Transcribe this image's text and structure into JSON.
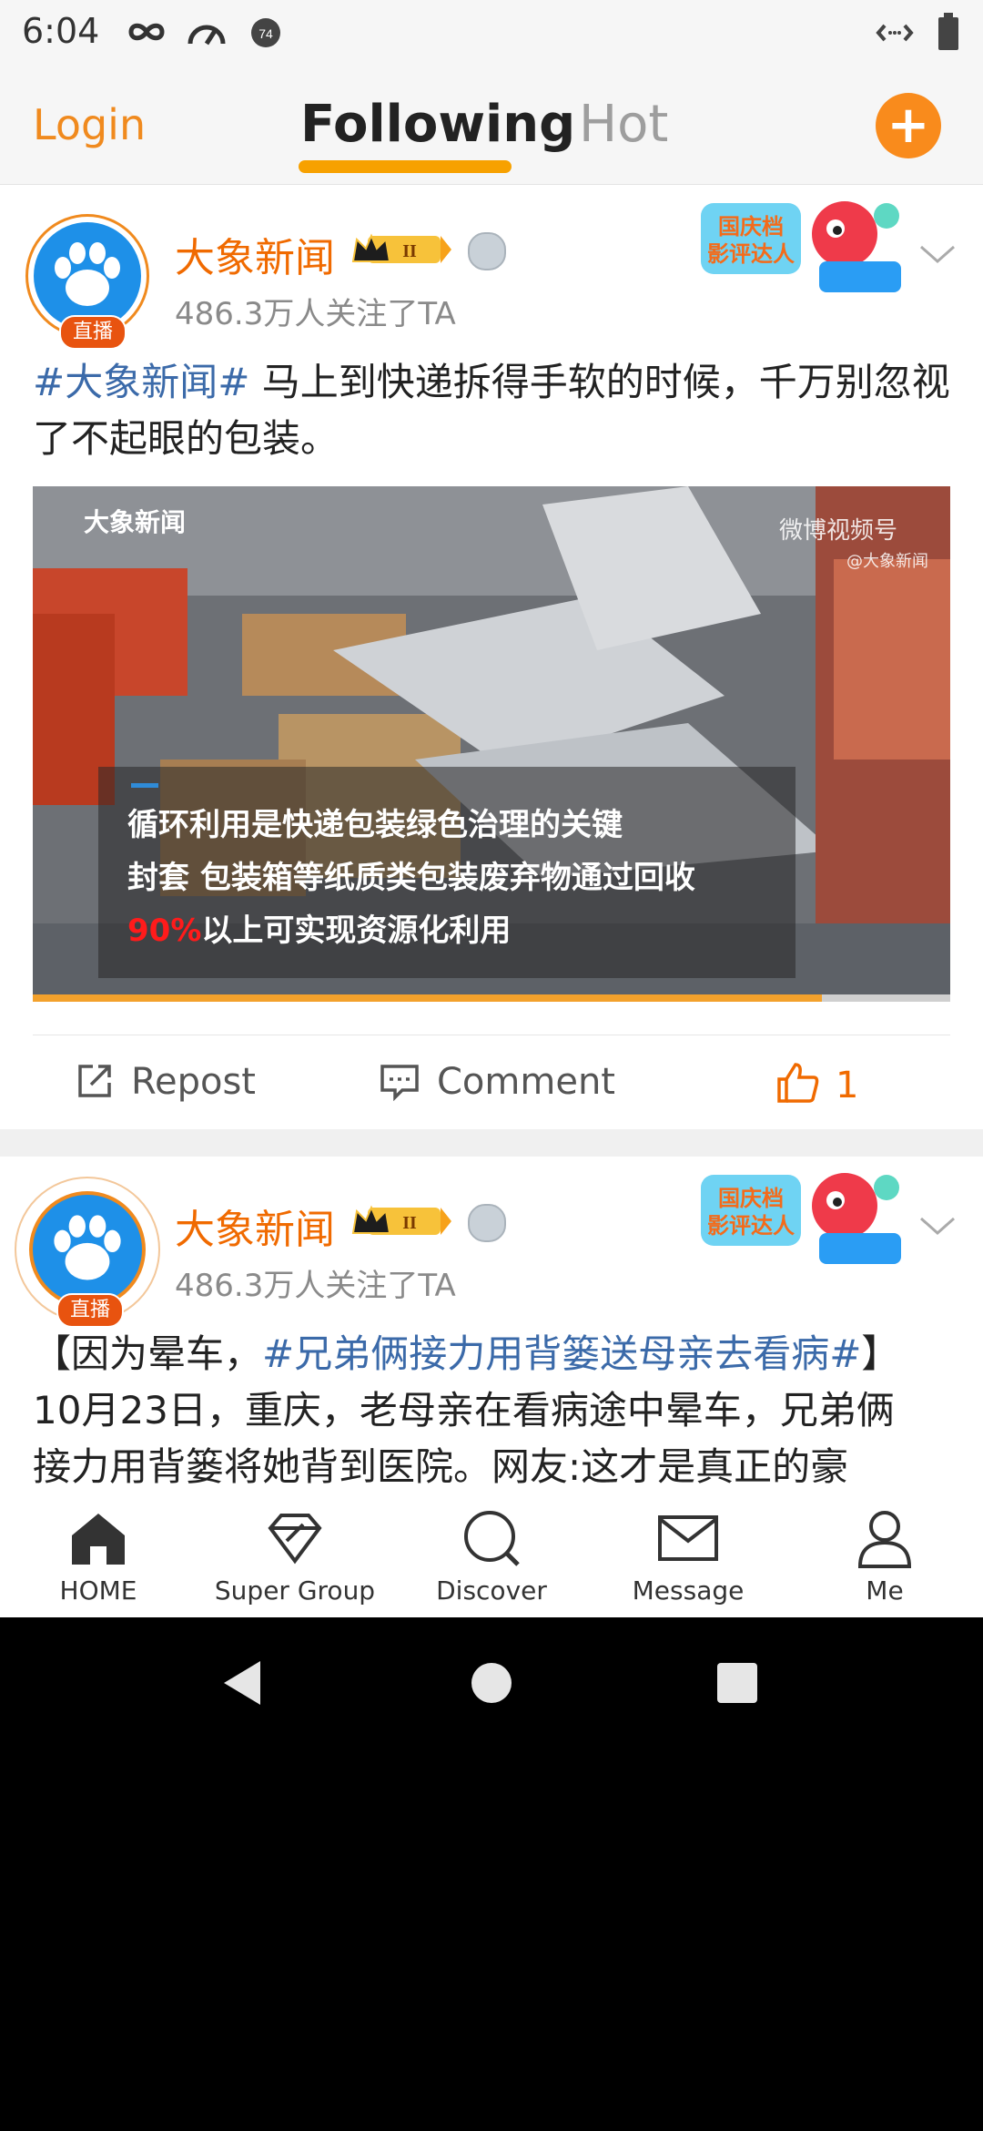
{
  "status_bar": {
    "time": "6:04",
    "icons": [
      "infinity-icon",
      "speedometer-icon",
      "notification-74-icon",
      "data-arrows-icon",
      "battery-icon"
    ]
  },
  "top_nav": {
    "login": "Login",
    "tabs": [
      "Following",
      "Hot"
    ],
    "active_tab": "Following",
    "add_button": "+"
  },
  "posts": [
    {
      "username": "大象新闻",
      "vip_level": "II",
      "live_badge": "直播",
      "followers": "486.3万人关注了TA",
      "hashtag": "#大象新闻#",
      "text": " 马上到快递拆得手软的时候，千万别忽视了不起眼的包装。",
      "video": {
        "logo": "大象新闻",
        "watermark": "微博视频号",
        "watermark_sub": "@大象新闻",
        "caption_line1": "循环利用是快递包装绿色治理的关键",
        "caption_line2": "封套 包装箱等纸质类包装废弃物通过回收",
        "caption_highlight": "90%",
        "caption_line3_rest": "以上可实现资源化利用",
        "progress": 0.86
      },
      "actions": {
        "repost": "Repost",
        "comment": "Comment",
        "likes": "1"
      }
    },
    {
      "username": "大象新闻",
      "vip_level": "II",
      "live_badge": "直播",
      "followers": "486.3万人关注了TA",
      "text_prefix": "【因为晕车，",
      "hashtag": "#兄弟俩接力用背篓送母亲去看病#",
      "text_suffix": "】",
      "text_line2": "10月23日，重庆，老母亲在看病途中晕车，兄弟俩",
      "text_line3": "接力用背篓将她背到医院。网友:这才是真正的豪"
    }
  ],
  "bottom_nav": {
    "items": [
      {
        "label": "HOME",
        "icon": "home-icon"
      },
      {
        "label": "Super Group",
        "icon": "diamond-icon"
      },
      {
        "label": "Discover",
        "icon": "search-icon"
      },
      {
        "label": "Message",
        "icon": "mail-icon"
      },
      {
        "label": "Me",
        "icon": "person-icon"
      }
    ]
  },
  "colors": {
    "accent": "#f08a1e",
    "link": "#3b6aa9",
    "tab_underline": "#f7a100"
  }
}
